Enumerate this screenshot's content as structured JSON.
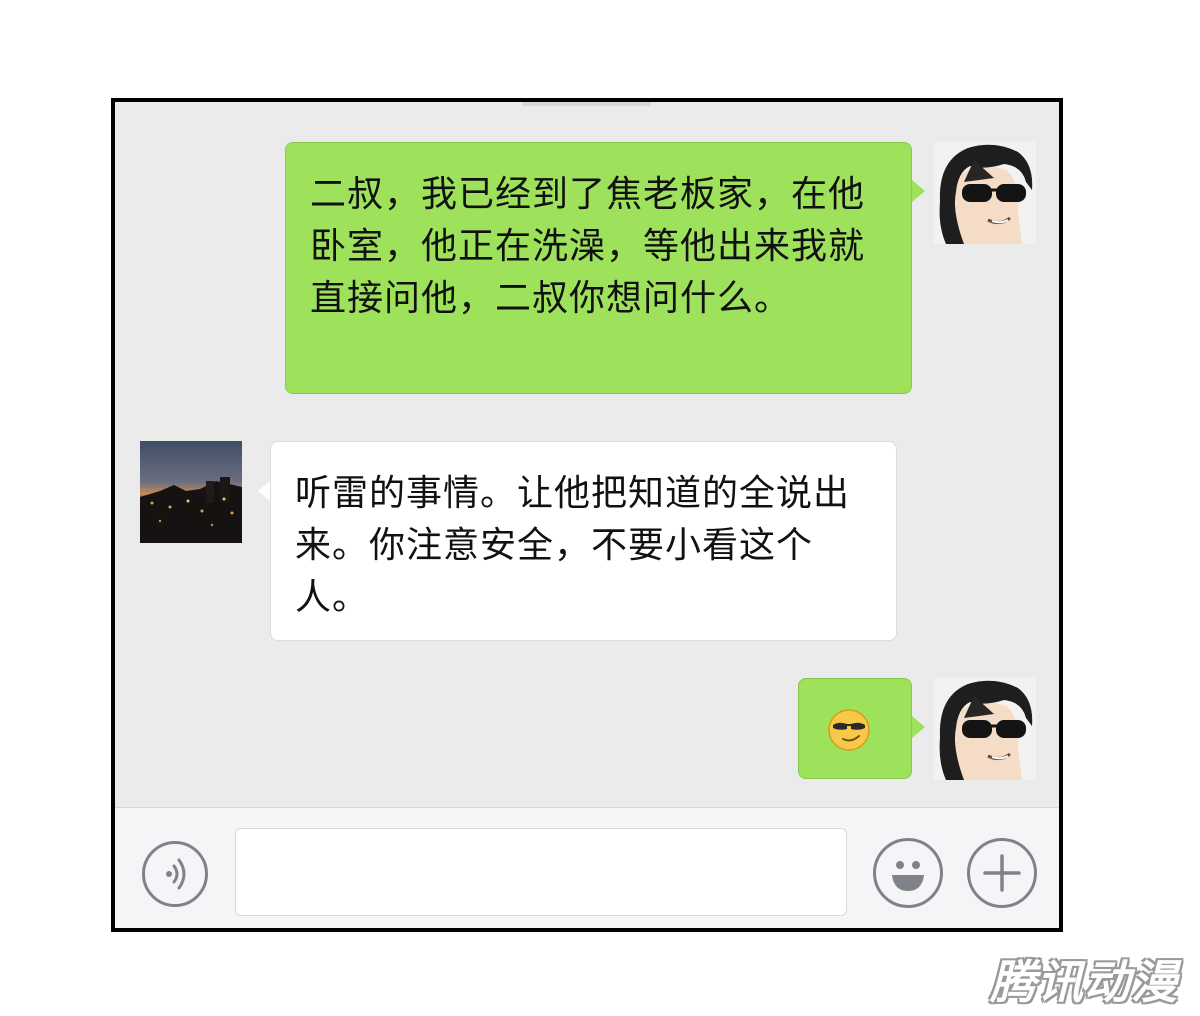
{
  "chat": {
    "messages": [
      {
        "sender": "me",
        "text": "二叔，我已经到了焦老板家，在他卧室，他正在洗澡，等他出来我就直接问他，二叔你想问什么。"
      },
      {
        "sender": "other",
        "text": "听雷的事情。让他把知道的全说出来。你注意安全，不要小看这个人。"
      },
      {
        "sender": "me",
        "emoji": "sunglasses-smirk-emoji"
      }
    ]
  },
  "input_bar": {
    "voice_icon": "voice-wave-icon",
    "message_value": "",
    "emoji_icon": "smiley-icon",
    "plus_icon": "plus-icon"
  },
  "watermark": "腾讯动漫",
  "colors": {
    "my_bubble": "#9de25a",
    "other_bubble": "#ffffff",
    "chat_bg": "#ebebeb",
    "input_bar_bg": "#f5f5f7"
  }
}
